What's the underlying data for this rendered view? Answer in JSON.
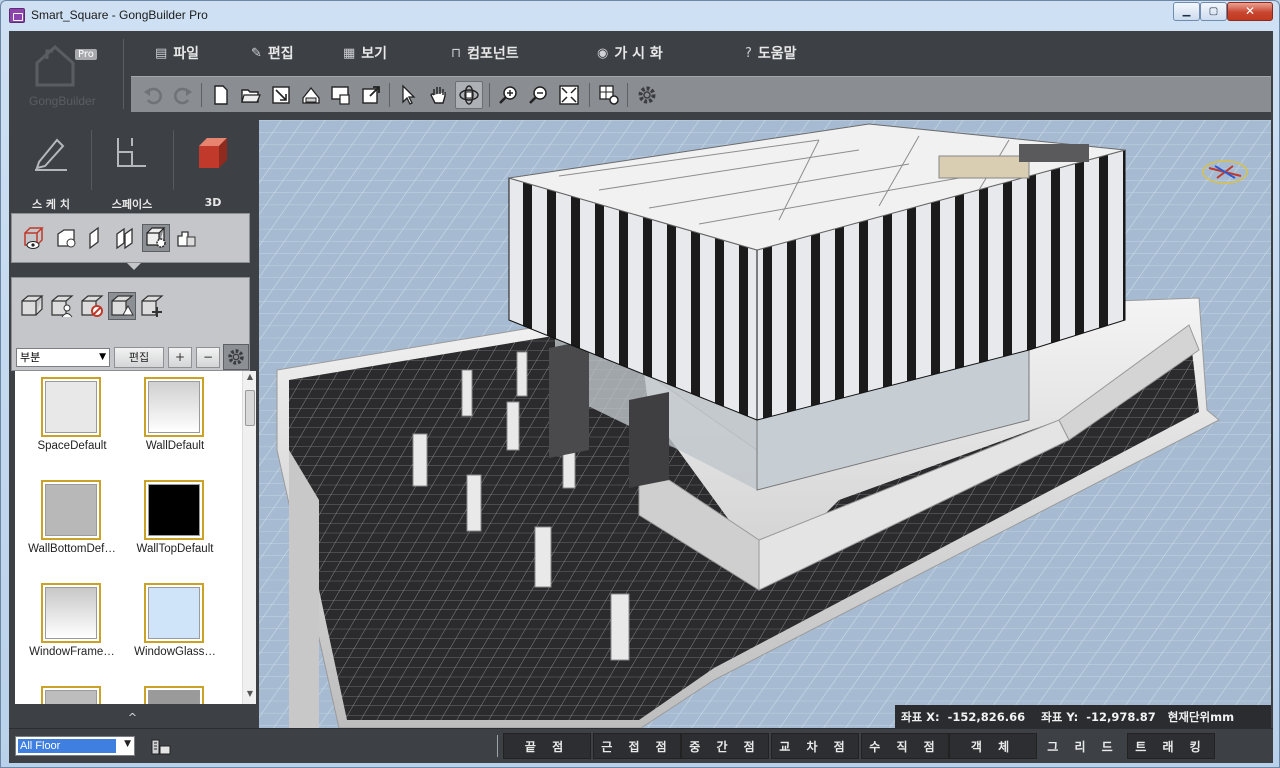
{
  "window": {
    "title": "Smart_Square - GongBuilder Pro",
    "min_label": "▁",
    "max_label": "▢",
    "close_label": "✕"
  },
  "logo": {
    "text": "GongBuilder",
    "badge": "Pro"
  },
  "menu": [
    {
      "label": "파일",
      "icon": "file-menu-icon"
    },
    {
      "label": "편집",
      "icon": "pencil-icon"
    },
    {
      "label": "보기",
      "icon": "view-grid-icon"
    },
    {
      "label": "컴포넌트",
      "icon": "component-icon"
    },
    {
      "label": "가 시 화",
      "icon": "eye-icon"
    },
    {
      "label": "도움말",
      "icon": "question-icon"
    }
  ],
  "toolbar_icons": [
    "undo-icon",
    "redo-icon",
    "new-file-icon",
    "open-folder-icon",
    "import-icon",
    "save-icon",
    "export-icon",
    "share-icon",
    "select-arrow-icon",
    "pan-hand-icon",
    "orbit-icon",
    "zoom-in-icon",
    "zoom-out-icon",
    "fit-view-icon",
    "render-settings-icon",
    "settings-gear-icon"
  ],
  "modes": [
    {
      "label": "스 케 치",
      "icon": "sketch-pencil-icon"
    },
    {
      "label": "스페이스",
      "icon": "space-plan-icon"
    },
    {
      "label": "3D",
      "icon": "cube-3d-icon"
    }
  ],
  "subtools": [
    "view-3d-icon",
    "camera-add-icon",
    "wall-panel-icon",
    "double-wall-icon",
    "material-settings-icon",
    "layer-view-icon"
  ],
  "material_tools": [
    "material-box-icon",
    "material-user-icon",
    "material-remove-icon",
    "material-pick-icon",
    "material-add-icon"
  ],
  "category": {
    "value": "부분",
    "edit_label": "편집",
    "plus_label": "+",
    "minus_label": "−"
  },
  "materials": [
    {
      "name": "SpaceDefault",
      "color": "#e8e8e8"
    },
    {
      "name": "WallDefault",
      "color": "#d0d0d0"
    },
    {
      "name": "WallBottomDef…",
      "color": "#b8b8b8"
    },
    {
      "name": "WallTopDefault",
      "color": "#000000"
    },
    {
      "name": "WindowFrame…",
      "color": "#c8c8c8"
    },
    {
      "name": "WindowGlass…",
      "color": "#cfe4f8"
    },
    {
      "name": "",
      "color": "#bdbdbd"
    },
    {
      "name": "",
      "color": "#9a9a9a"
    }
  ],
  "collapse_label": "^",
  "coords": {
    "x_label": "좌표 X:",
    "x_value": "-152,826.66",
    "y_label": "좌표 Y:",
    "y_value": "-12,978.87",
    "unit_label": "현재단위mm"
  },
  "floor": {
    "value": "All Floor"
  },
  "snaps": [
    {
      "label": "끝 점",
      "on": true
    },
    {
      "label": "근 접 점",
      "on": true
    },
    {
      "label": "중 간 점",
      "on": true
    },
    {
      "label": "교 차 점",
      "on": true
    },
    {
      "label": "수 직 점",
      "on": true
    },
    {
      "label": "객 체",
      "on": true
    },
    {
      "label": "그 리 드",
      "on": false
    },
    {
      "label": "트 래 킹",
      "on": true
    }
  ],
  "colors": {
    "accent": "#c0392b",
    "chrome": "#3d4045",
    "toolbar": "#8a8d92"
  }
}
